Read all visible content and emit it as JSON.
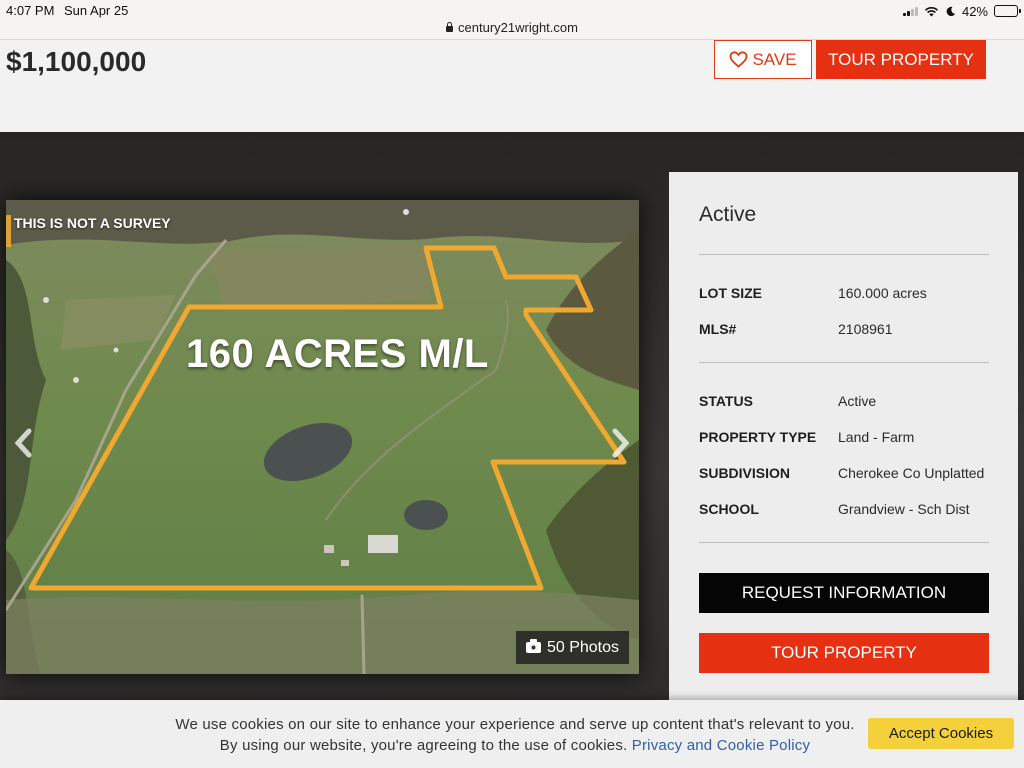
{
  "status_bar": {
    "time": "4:07 PM",
    "date": "Sun Apr 25",
    "url": "century21wright.com",
    "battery": "42%",
    "battery_level": 0.42
  },
  "header": {
    "price": "$1,100,000",
    "save_label": "SAVE",
    "tour_label": "TOUR PROPERTY"
  },
  "photo": {
    "survey_note": "THIS IS NOT A SURVEY",
    "overlay_text": "160 ACRES M/L",
    "photos_count": "50 Photos"
  },
  "panel": {
    "status_heading": "Active",
    "details": [
      {
        "label": "LOT SIZE",
        "value": "160.000 acres"
      },
      {
        "label": "MLS#",
        "value": "2108961"
      }
    ],
    "attributes": [
      {
        "label": "STATUS",
        "value": "Active"
      },
      {
        "label": "PROPERTY TYPE",
        "value": "Land - Farm"
      },
      {
        "label": "SUBDIVISION",
        "value": "Cherokee Co Unplatted"
      },
      {
        "label": "SCHOOL",
        "value": "Grandview - Sch Dist"
      }
    ],
    "request_label": "REQUEST INFORMATION",
    "tour_label": "TOUR PROPERTY"
  },
  "cookie": {
    "text": "We use cookies on our site to enhance your experience and serve up content that's relevant to you. By using our website, you're agreeing to the use of cookies.",
    "link": "Privacy and Cookie Policy",
    "accept_label": "Accept Cookies"
  },
  "colors": {
    "brand_red": "#e53012",
    "accept_yellow": "#f4d03a",
    "boundary_orange": "#f0a830"
  }
}
